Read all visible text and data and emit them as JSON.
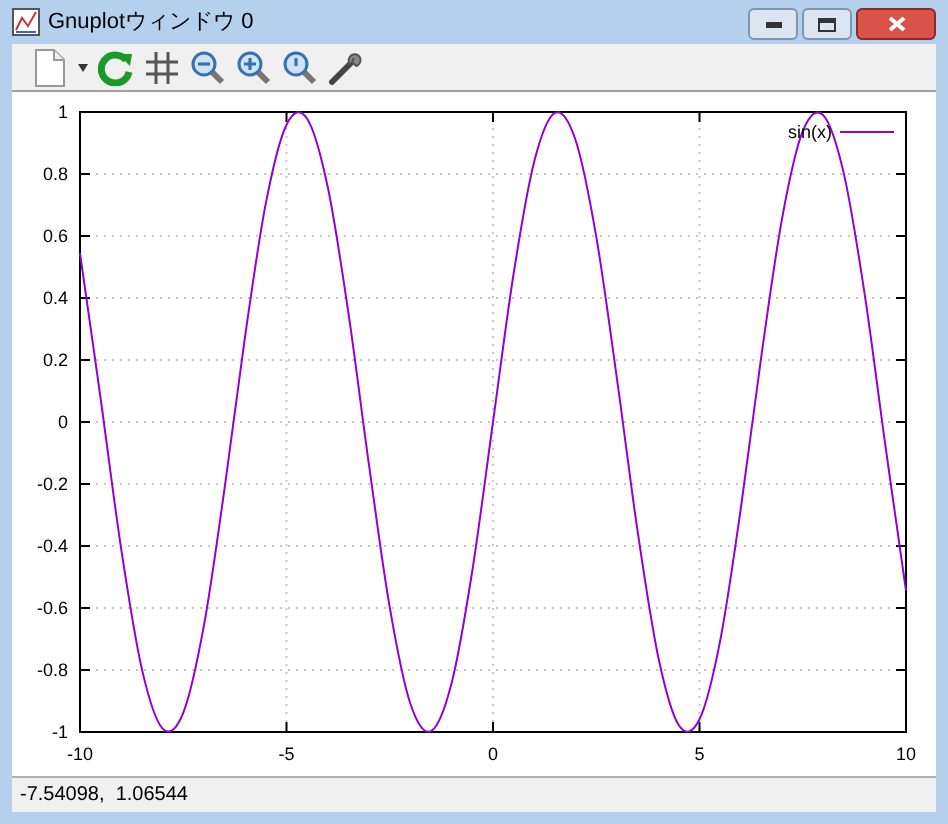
{
  "window": {
    "title": "Gnuplotウィンドウ 0"
  },
  "toolbar": {
    "items": [
      {
        "kind": "page"
      },
      {
        "kind": "caret"
      },
      {
        "kind": "refresh"
      },
      {
        "kind": "grid"
      },
      {
        "kind": "zoom-out"
      },
      {
        "kind": "zoom-in"
      },
      {
        "kind": "zoom-reset"
      },
      {
        "kind": "wrench"
      }
    ]
  },
  "plot": {
    "chart_data": {
      "type": "line",
      "grid": true,
      "xlim": [
        -10,
        10
      ],
      "ylim": [
        -1,
        1
      ],
      "xticks": [
        -10,
        -5,
        0,
        5,
        10
      ],
      "yticks": [
        -1,
        -0.8,
        -0.6,
        -0.4,
        -0.2,
        0,
        0.2,
        0.4,
        0.6,
        0.8,
        1
      ],
      "x": [
        -10,
        -9.5,
        -9,
        -8.5,
        -8,
        -7.5,
        -7,
        -6.5,
        -6,
        -5.5,
        -5,
        -4.5,
        -4,
        -3.5,
        -3,
        -2.5,
        -2,
        -1.5,
        -1,
        -0.5,
        0,
        0.5,
        1,
        1.5,
        2,
        2.5,
        3,
        3.5,
        4,
        4.5,
        5,
        5.5,
        6,
        6.5,
        7,
        7.5,
        8,
        8.5,
        9,
        9.5,
        10
      ],
      "series": [
        {
          "name": "sin(x)",
          "color": "#9400d3",
          "values": [
            0.544,
            0.075,
            -0.412,
            -0.798,
            -0.989,
            -0.938,
            -0.657,
            -0.215,
            0.279,
            0.706,
            0.959,
            0.978,
            0.757,
            0.351,
            -0.141,
            -0.598,
            -0.909,
            -0.997,
            -0.841,
            -0.479,
            0,
            0.479,
            0.841,
            0.997,
            0.909,
            0.598,
            0.141,
            -0.351,
            -0.757,
            -0.978,
            -0.959,
            -0.706,
            -0.279,
            0.215,
            0.657,
            0.938,
            0.989,
            0.798,
            0.412,
            -0.075,
            -0.544
          ]
        }
      ]
    }
  },
  "status_bar": {
    "text": "-7.54098,  1.06544"
  }
}
